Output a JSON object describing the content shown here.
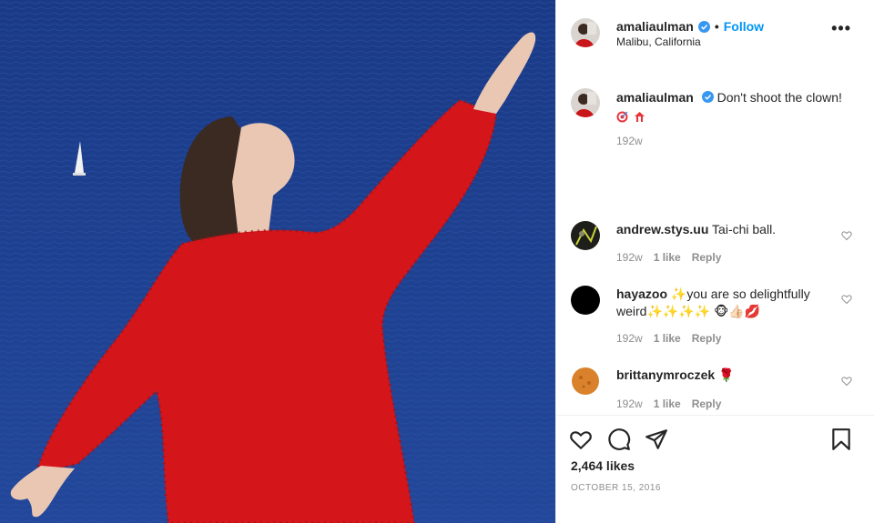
{
  "post": {
    "author": "amaliaulman",
    "follow_label": "Follow",
    "dot": "•",
    "location": "Malibu, California",
    "more_label": "•••",
    "caption_text": "Don't shoot the clown!",
    "caption_time": "192w"
  },
  "comments": [
    {
      "user": "andrew.stys.uu",
      "text": "Tai-chi ball.",
      "time": "192w",
      "likes": "1 like",
      "reply": "Reply"
    },
    {
      "user": "hayazoo",
      "text_a": "✨you are so delightfully weird✨✨✨✨",
      "text_b": "🐵👍🏻💋",
      "time": "192w",
      "likes": "1 like",
      "reply": "Reply"
    },
    {
      "user": "brittanymroczek",
      "text": "🌹",
      "time": "192w",
      "likes": "1 like",
      "reply": "Reply"
    }
  ],
  "engagement": {
    "likes": "2,464 likes",
    "date": "OCTOBER 15, 2016"
  },
  "icons": {
    "verified": "verified-badge-icon",
    "like": "heart-icon",
    "comment": "comment-bubble-icon",
    "share": "paper-plane-icon",
    "save": "bookmark-icon"
  },
  "colors": {
    "accent": "#0095f6",
    "text": "#262626",
    "muted": "#8e8e8e",
    "sea": "#1c3f8e",
    "sweater": "#d4161a"
  }
}
